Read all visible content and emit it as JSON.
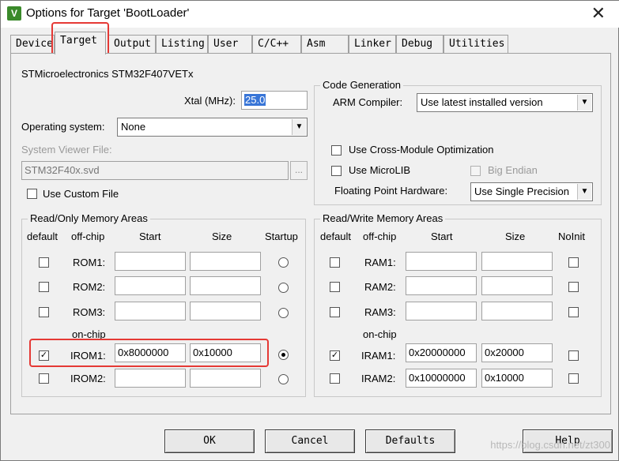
{
  "window": {
    "title": "Options for Target 'BootLoader'",
    "close_glyph": "✕",
    "icon_letter": "V"
  },
  "tabs": [
    {
      "label": "Device"
    },
    {
      "label": "Target"
    },
    {
      "label": "Output"
    },
    {
      "label": "Listing"
    },
    {
      "label": "User"
    },
    {
      "label": "C/C++"
    },
    {
      "label": "Asm"
    },
    {
      "label": "Linker"
    },
    {
      "label": "Debug"
    },
    {
      "label": "Utilities"
    }
  ],
  "active_tab": "Target",
  "target": {
    "device_name": "STMicroelectronics STM32F407VETx",
    "xtal_label": "Xtal (MHz):",
    "xtal_value": "25.0",
    "os_label": "Operating system:",
    "os_value": "None",
    "svd_label": "System Viewer File:",
    "svd_value": "STM32F40x.svd",
    "browse_label": "...",
    "custom_file_label": "Use Custom File"
  },
  "codegen": {
    "legend": "Code Generation",
    "compiler_label": "ARM Compiler:",
    "compiler_value": "Use latest installed version",
    "cross_module_label": "Use Cross-Module Optimization",
    "microlib_label": "Use MicroLIB",
    "big_endian_label": "Big Endian",
    "fp_label": "Floating Point Hardware:",
    "fp_value": "Use Single Precision"
  },
  "rom": {
    "legend": "Read/Only Memory Areas",
    "headers": {
      "default": "default",
      "offchip": "off-chip",
      "start": "Start",
      "size": "Size",
      "startup": "Startup"
    },
    "onchip_label": "on-chip",
    "rows": [
      {
        "name": "ROM1:",
        "start": "",
        "size": "",
        "default": false,
        "startup": false
      },
      {
        "name": "ROM2:",
        "start": "",
        "size": "",
        "default": false,
        "startup": false
      },
      {
        "name": "ROM3:",
        "start": "",
        "size": "",
        "default": false,
        "startup": false
      },
      {
        "name": "IROM1:",
        "start": "0x8000000",
        "size": "0x10000",
        "default": true,
        "startup": true
      },
      {
        "name": "IROM2:",
        "start": "",
        "size": "",
        "default": false,
        "startup": false
      }
    ]
  },
  "ram": {
    "legend": "Read/Write Memory Areas",
    "headers": {
      "default": "default",
      "offchip": "off-chip",
      "start": "Start",
      "size": "Size",
      "noinit": "NoInit"
    },
    "onchip_label": "on-chip",
    "rows": [
      {
        "name": "RAM1:",
        "start": "",
        "size": "",
        "default": false,
        "noinit": false
      },
      {
        "name": "RAM2:",
        "start": "",
        "size": "",
        "default": false,
        "noinit": false
      },
      {
        "name": "RAM3:",
        "start": "",
        "size": "",
        "default": false,
        "noinit": false
      },
      {
        "name": "IRAM1:",
        "start": "0x20000000",
        "size": "0x20000",
        "default": true,
        "noinit": false
      },
      {
        "name": "IRAM2:",
        "start": "0x10000000",
        "size": "0x10000",
        "default": false,
        "noinit": false
      }
    ]
  },
  "buttons": {
    "ok": "OK",
    "cancel": "Cancel",
    "defaults": "Defaults",
    "help": "Help"
  },
  "watermark": "https://blog.csdn.net/zt300",
  "check_glyph": "✓",
  "arrow_glyph": "▼",
  "colors": {
    "highlight": "#e53935",
    "xtal_selection": "#3875d7"
  }
}
